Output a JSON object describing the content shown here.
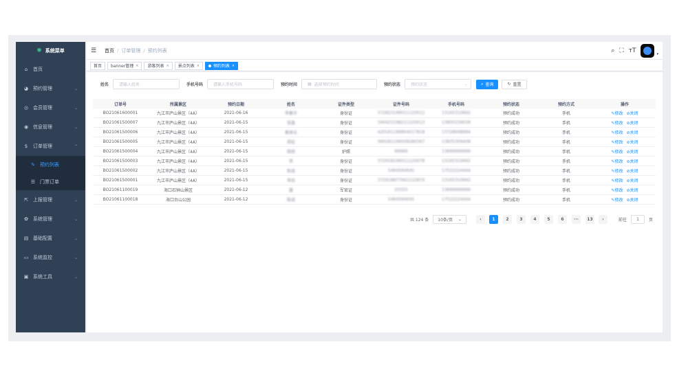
{
  "sidebar": {
    "title": "系统菜单",
    "items": [
      {
        "label": "首页",
        "icon": "dashboard-icon",
        "glyph": "⌂"
      },
      {
        "label": "预约管理",
        "icon": "calendar-icon",
        "glyph": "◕",
        "arrow": "⌄"
      },
      {
        "label": "会员管理",
        "icon": "github-icon",
        "glyph": "◎",
        "arrow": "⌄"
      },
      {
        "label": "信息管理",
        "icon": "eye-icon",
        "glyph": "◉",
        "arrow": "⌄"
      },
      {
        "label": "订单管理",
        "icon": "money-icon",
        "glyph": "$",
        "arrow": "⌃"
      }
    ],
    "subitems": [
      {
        "label": "预约列表",
        "icon": "edit-icon",
        "glyph": "✎"
      },
      {
        "label": "门票订单",
        "icon": "list-icon",
        "glyph": "☰"
      }
    ],
    "items2": [
      {
        "label": "上报管理",
        "icon": "external-icon",
        "glyph": "⇱",
        "arrow": "⌄"
      },
      {
        "label": "系统管理",
        "icon": "gear-icon",
        "glyph": "✿",
        "arrow": "⌄"
      },
      {
        "label": "基础配置",
        "icon": "form-icon",
        "glyph": "▤",
        "arrow": "⌄"
      },
      {
        "label": "系统监控",
        "icon": "monitor-icon",
        "glyph": "▭",
        "arrow": "⌄"
      },
      {
        "label": "系统工具",
        "icon": "tool-icon",
        "glyph": "▣",
        "arrow": "⌄"
      }
    ]
  },
  "navbar": {
    "breadcrumb": [
      "首页",
      "订单管理",
      "预约列表"
    ],
    "separator": "/",
    "hamburger": "☰",
    "tools": {
      "search": "⌕",
      "fullscreen": "⛶",
      "size": "тT",
      "caret": "▾"
    }
  },
  "tags": [
    {
      "label": "首页",
      "closable": false
    },
    {
      "label": "banner管理",
      "closable": true
    },
    {
      "label": "游客列表",
      "closable": true
    },
    {
      "label": "景点列表",
      "closable": true
    },
    {
      "label": "预约列表",
      "closable": true,
      "active": true
    }
  ],
  "tag_close": "×",
  "filters": {
    "name_label": "姓名",
    "name_placeholder": "请输入姓名",
    "phone_label": "手机号码",
    "phone_placeholder": "请输入手机号码",
    "time_label": "预约时间",
    "time_placeholder": "选择预约时间",
    "status_label": "预约状态",
    "status_placeholder": "预约状态",
    "search_button": "查询",
    "reset_button": "重置",
    "search_glyph": "⌕",
    "reset_glyph": "↻",
    "calendar_glyph": "▦",
    "select_glyph": "⌄"
  },
  "table": {
    "headers": [
      "订单号",
      "所属景区",
      "预约日期",
      "姓名",
      "证件类型",
      "证件号码",
      "手机号码",
      "预约状态",
      "预约方式",
      "操作"
    ],
    "rows": [
      [
        "BO21061600001",
        "九江市庐山景区（4A）",
        "2021-06-16",
        "李春华",
        "身份证",
        "372823199011120012",
        "13165310662",
        "预约成功",
        "手机"
      ],
      [
        "BO21061500007",
        "九江市庐山景区（4A）",
        "2021-06-15",
        "张鑫",
        "身份证",
        "340425198211220013",
        "13800159039",
        "预约成功",
        "手机"
      ],
      [
        "BO21061500006",
        "九江市庐山景区（4A）",
        "2021-06-15",
        "姜承业",
        "身份证",
        "420161199804017818",
        "13728698684",
        "预约成功",
        "手机"
      ],
      [
        "BO21061500005",
        "九江市庐山景区（4A）",
        "2021-06-15",
        "郑征",
        "身份证",
        "360281199509280367",
        "13835309408",
        "预约成功",
        "手机"
      ],
      [
        "BO21061500004",
        "九江市庐山景区（4A）",
        "2021-06-15",
        "杨扬",
        "护照",
        "66666",
        "13666666666",
        "预约成功",
        "手机"
      ],
      [
        "BO21061500003",
        "九江市庐山景区（4A）",
        "2021-06-15",
        "李",
        "身份证",
        "372918199011120078",
        "13165310662",
        "预约成功",
        "手机"
      ],
      [
        "BO21061500002",
        "九江市庐山景区（4A）",
        "2021-06-15",
        "陈成",
        "身份证",
        "5464564645",
        "17522224444",
        "预约成功",
        "手机"
      ],
      [
        "BO21061500001",
        "九江市庐山景区（4A）",
        "2021-06-15",
        "李估",
        "身份证",
        "372918877661122874",
        "13165310662",
        "预约成功",
        "手机"
      ],
      [
        "BO21061100019",
        "海口石钟山景区",
        "2021-06-12",
        "嘉",
        "军官证",
        "25555",
        "13666666666",
        "预约成功",
        "手机"
      ],
      [
        "BO21061100018",
        "海口台山公园",
        "2021-06-12",
        "陈成",
        "身份证",
        "5464564645",
        "17522224444",
        "预约成功",
        "手机"
      ]
    ],
    "op_edit": "修改",
    "op_close": "关闭",
    "edit_glyph": "✎",
    "close_glyph": "⊘"
  },
  "pagination": {
    "total_text": "共 124 条",
    "page_size": "10条/页",
    "prev": "‹",
    "next": "›",
    "pages": [
      "1",
      "2",
      "3",
      "4",
      "5",
      "6",
      "···",
      "13"
    ],
    "current": "1",
    "goto_label": "前往",
    "goto_value": "1",
    "goto_suffix": "页"
  },
  "colors": {
    "sidebar_bg": "#304156",
    "submenu_bg": "#1f2d3d",
    "accent": "#1890ff"
  }
}
